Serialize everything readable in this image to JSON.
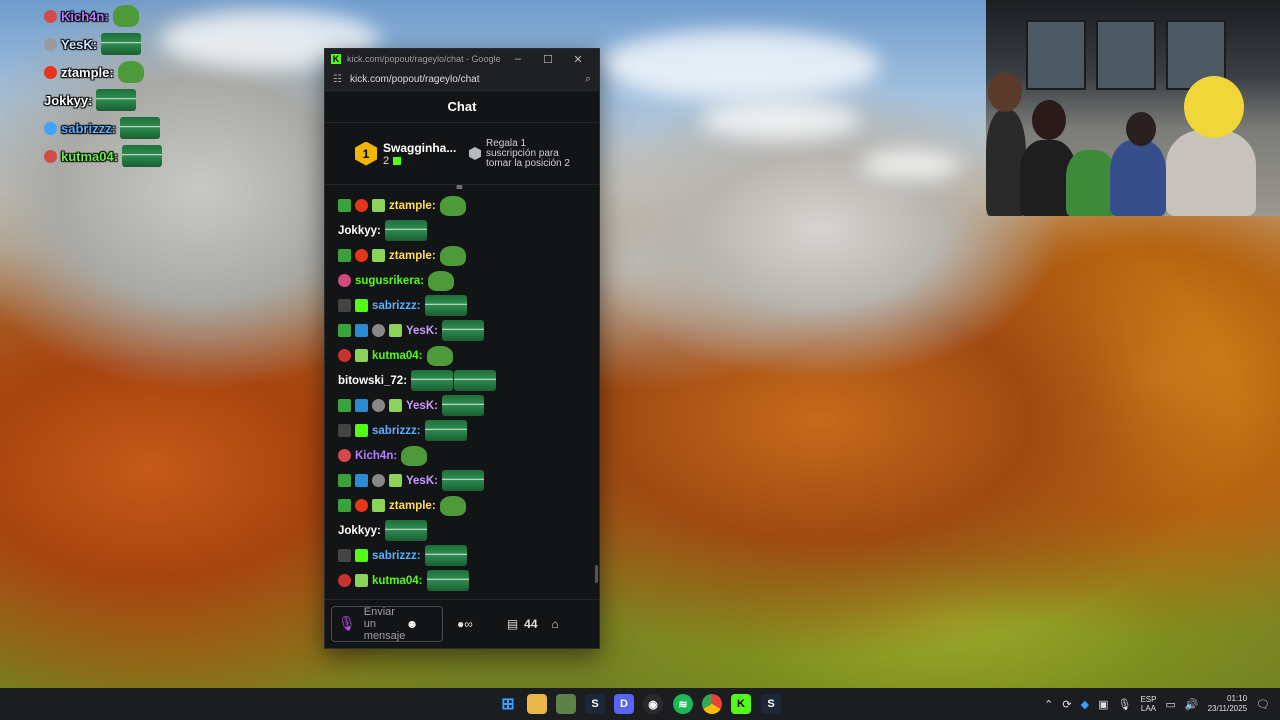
{
  "overlay_chat": [
    {
      "name": "Kich4n:",
      "color": "#b47bff",
      "badge": "#d24a4a"
    },
    {
      "name": "YesK:",
      "color": "#cde2ff",
      "badge": "#9a9a9a"
    },
    {
      "name": "ztample:",
      "color": "#ffffff",
      "badge": "#e5361b"
    },
    {
      "name": "Jokkyy:",
      "color": "#ffffff",
      "badge": ""
    },
    {
      "name": "sabrizzz:",
      "color": "#5ab0ff",
      "badge": "#3fa3ff"
    },
    {
      "name": "kutma04:",
      "color": "#6cf04c",
      "badge": "#d24a4a"
    }
  ],
  "browser": {
    "title": "kick.com/popout/rageylo/chat - Google Chro...",
    "url": "kick.com/popout/rageylo/chat"
  },
  "chat": {
    "header": "Chat",
    "leader": {
      "rank": "1",
      "name": "Swagginha...",
      "count": "2"
    },
    "gift_prompt": "Regala 1 suscripción para tomar la posición 2",
    "messages": [
      {
        "user": "ztample:",
        "color": "#ffde59",
        "badges": [
          "#3ba13b",
          "#e5361b",
          "#8bd35b"
        ],
        "emotes": [
          "pepe"
        ]
      },
      {
        "user": "Jokkyy:",
        "color": "#ffffff",
        "badges": [],
        "emotes": [
          "mexico"
        ]
      },
      {
        "user": "ztample:",
        "color": "#ffde59",
        "badges": [
          "#3ba13b",
          "#e5361b",
          "#8bd35b"
        ],
        "emotes": [
          "pepe"
        ]
      },
      {
        "user": "sugusrikera:",
        "color": "#53fc18",
        "badges": [
          "#d24a7a"
        ],
        "emotes": [
          "pepe"
        ]
      },
      {
        "user": "sabrizzz:",
        "color": "#5ab0ff",
        "badges": [
          "#444",
          "#53fc18"
        ],
        "emotes": [
          "mexico"
        ]
      },
      {
        "user": "YesK:",
        "color": "#c99cff",
        "badges": [
          "#3ba13b",
          "#2d8ad6",
          "#888",
          "#8bd35b"
        ],
        "emotes": [
          "mexico"
        ]
      },
      {
        "user": "kutma04:",
        "color": "#53fc18",
        "badges": [
          "#c8322f",
          "#8bd35b"
        ],
        "emotes": [
          "pepe"
        ]
      },
      {
        "user": "bitowski_72:",
        "color": "#ffffff",
        "badges": [],
        "emotes": [
          "mexico",
          "mexico"
        ]
      },
      {
        "user": "YesK:",
        "color": "#c99cff",
        "badges": [
          "#3ba13b",
          "#2d8ad6",
          "#888",
          "#8bd35b"
        ],
        "emotes": [
          "mexico"
        ]
      },
      {
        "user": "sabrizzz:",
        "color": "#5ab0ff",
        "badges": [
          "#444",
          "#53fc18"
        ],
        "emotes": [
          "mexico"
        ]
      },
      {
        "user": "Kich4n:",
        "color": "#b47bff",
        "badges": [
          "#d24a4a"
        ],
        "emotes": [
          "pepe"
        ]
      },
      {
        "user": "YesK:",
        "color": "#c99cff",
        "badges": [
          "#3ba13b",
          "#2d8ad6",
          "#888",
          "#8bd35b"
        ],
        "emotes": [
          "mexico"
        ]
      },
      {
        "user": "ztample:",
        "color": "#ffde59",
        "badges": [
          "#3ba13b",
          "#e5361b",
          "#8bd35b"
        ],
        "emotes": [
          "pepe"
        ]
      },
      {
        "user": "Jokkyy:",
        "color": "#ffffff",
        "badges": [],
        "emotes": [
          "mexico"
        ]
      },
      {
        "user": "sabrizzz:",
        "color": "#5ab0ff",
        "badges": [
          "#444",
          "#53fc18"
        ],
        "emotes": [
          "mexico"
        ]
      },
      {
        "user": "kutma04:",
        "color": "#53fc18",
        "badges": [
          "#c8322f",
          "#8bd35b"
        ],
        "emotes": [
          "mexico"
        ]
      }
    ],
    "input_placeholder": "Enviar un mensaje",
    "points": "44"
  },
  "taskbar": {
    "apps": [
      "start-icon",
      "file-explorer-icon",
      "app-icon",
      "steam-icon",
      "discord-icon",
      "obs-icon",
      "spotify-icon",
      "chrome-icon",
      "kick-icon",
      "steam-icon"
    ],
    "language": "ESP",
    "keyboard": "LAA",
    "time": "01:10",
    "date": "23/11/2025"
  },
  "colors": {
    "kick_green": "#53fc18",
    "panel_bg": "#131416"
  }
}
